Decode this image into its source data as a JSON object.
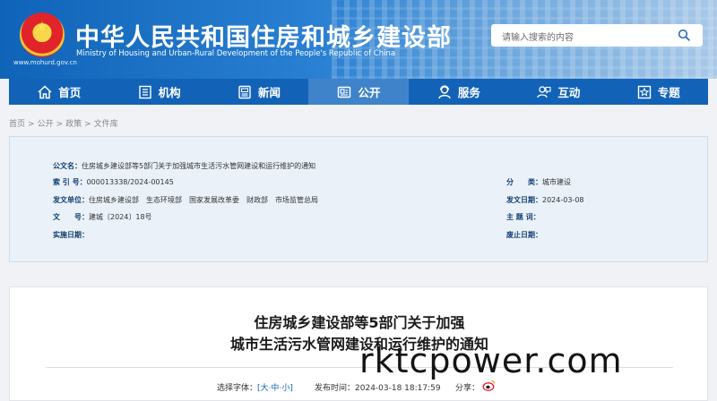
{
  "header": {
    "title_cn": "中华人民共和国住房和城乡建设部",
    "title_en": "Ministry of Housing and Urban-Rural Development of the People's Republic of China",
    "site_url": "www.mohurd.gov.cn",
    "search_placeholder": "请输入搜索的内容",
    "brand_color": "#1263b7"
  },
  "nav": [
    {
      "label": "首页",
      "icon": "home-icon"
    },
    {
      "label": "机构",
      "icon": "org-icon"
    },
    {
      "label": "新闻",
      "icon": "news-icon"
    },
    {
      "label": "公开",
      "icon": "disclosure-icon",
      "active": true
    },
    {
      "label": "服务",
      "icon": "service-icon"
    },
    {
      "label": "互动",
      "icon": "interaction-icon"
    },
    {
      "label": "专题",
      "icon": "topic-icon"
    }
  ],
  "breadcrumb": [
    "首页",
    ">",
    "公开",
    ">",
    "政策",
    ">",
    "文件库"
  ],
  "info": {
    "title_label": "公文名：",
    "title_value": "住房城乡建设部等5部门关于加强城市生活污水管网建设和运行维护的通知",
    "index_label": "索 引 号：",
    "index_value": "000013338/2024-00145",
    "category_label": "分　　类：",
    "category_value": "城市建设",
    "issuer_label": "发文单位：",
    "issuer_value": "住房城乡建设部　生态环境部　国家发展改革委　财政部　市场监管总局",
    "date_label": "发文日期：",
    "date_value": "2024-03-08",
    "docno_label": "文　　号：",
    "docno_value": "建城〔2024〕18号",
    "subject_label": "主 题 词：",
    "subject_value": "",
    "effective_label": "实施日期：",
    "effective_value": "",
    "repeal_label": "废止日期：",
    "repeal_value": ""
  },
  "article": {
    "title_line1": "住房城乡建设部等5部门关于加强",
    "title_line2": "城市生活污水管网建设和运行维护的通知",
    "font_label": "选择字体：",
    "font_open": "[",
    "font_large": "大",
    "font_sep1": "·",
    "font_mid": "中",
    "font_sep2": "·",
    "font_small": "小",
    "font_close": "]",
    "time_label": "发布时间：",
    "time_value": "2024-03-18 18:17:59",
    "share_label": "分享："
  },
  "watermark": "rktcpower.com"
}
